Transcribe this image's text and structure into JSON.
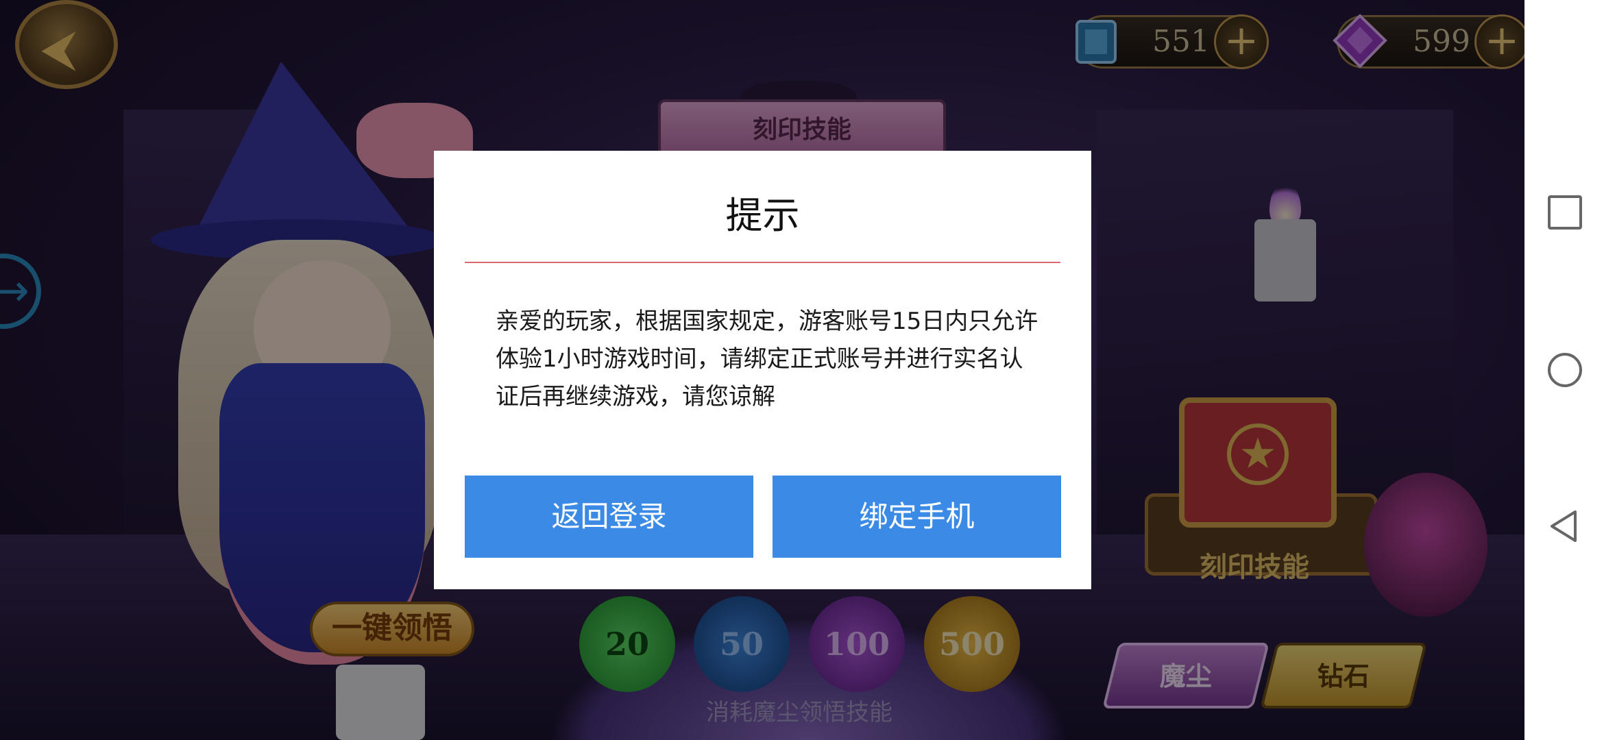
{
  "resources": {
    "crystal": {
      "value": "551",
      "icon": "crystal-icon"
    },
    "gem": {
      "value": "599",
      "icon": "purple-gem-icon"
    }
  },
  "scene": {
    "skill_banner": "刻印技能",
    "book_label": "刻印技能",
    "one_key_button": "一键领悟",
    "amounts": [
      "20",
      "50",
      "100",
      "500"
    ],
    "cost_tip": "消耗魔尘领悟技能",
    "tabs": {
      "magic_dust": "魔尘",
      "diamond": "钻石"
    }
  },
  "dialog": {
    "title": "提示",
    "message": "亲爱的玩家，根据国家规定，游客账号15日内只允许体验1小时游戏时间，请绑定正式账号并进行实名认证后再继续游戏，请您谅解",
    "back_login_button": "返回登录",
    "bind_phone_button": "绑定手机"
  },
  "colors": {
    "dialog_button": "#3a8ae6",
    "divider": "#d96a70",
    "background": "#2a1c44"
  }
}
